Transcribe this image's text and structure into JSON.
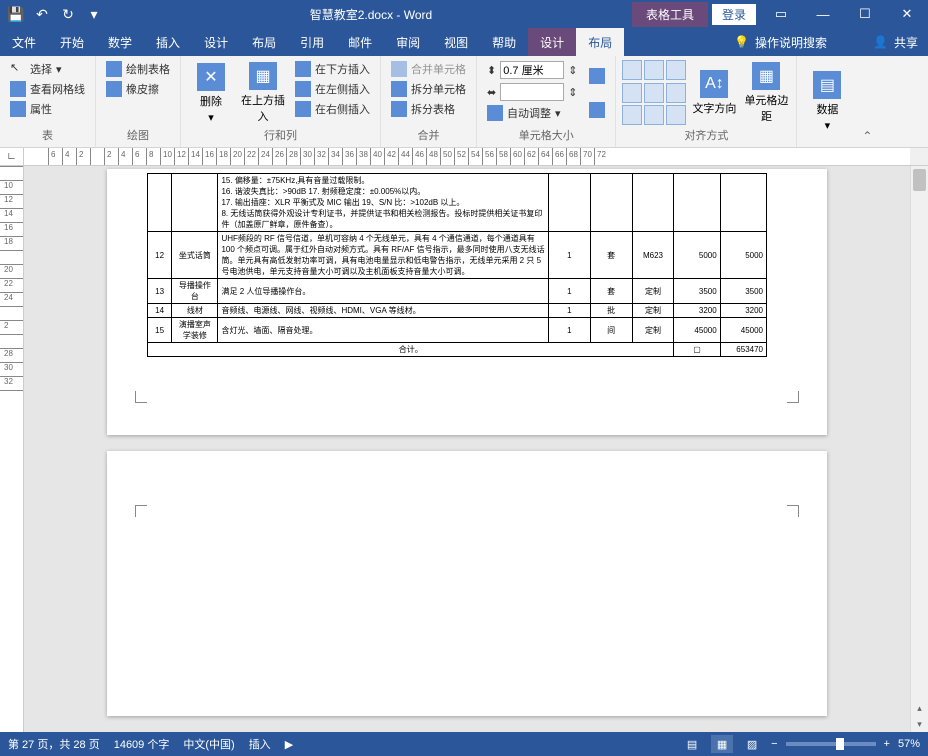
{
  "titlebar": {
    "doc_title": "智慧教室2.docx - Word",
    "tool_tab": "表格工具",
    "login": "登录"
  },
  "tabs": {
    "items": [
      "文件",
      "开始",
      "数学",
      "插入",
      "设计",
      "布局",
      "引用",
      "邮件",
      "审阅",
      "视图",
      "帮助",
      "设计",
      "布局"
    ],
    "active_index": 12,
    "tell_me": "操作说明搜索",
    "share": "共享"
  },
  "ribbon": {
    "group_table": {
      "label": "表",
      "select": "选择",
      "gridlines": "查看网格线",
      "properties": "属性"
    },
    "group_draw": {
      "label": "绘图",
      "draw": "绘制表格",
      "eraser": "橡皮擦"
    },
    "group_rowcol": {
      "label": "行和列",
      "delete": "删除",
      "insert_above": "在上方插入",
      "insert_below": "在下方插入",
      "insert_left": "在左侧插入",
      "insert_right": "在右侧插入"
    },
    "group_merge": {
      "label": "合并",
      "merge": "合并单元格",
      "split_cells": "拆分单元格",
      "split_table": "拆分表格"
    },
    "group_size": {
      "label": "单元格大小",
      "height": "0.7 厘米",
      "width": "",
      "autofit": "自动调整"
    },
    "group_align": {
      "label": "对齐方式",
      "text_dir": "文字方向",
      "cell_margin": "单元格边距"
    },
    "group_data": {
      "label": "数据",
      "btn": "数据"
    }
  },
  "ruler_h": [
    "6",
    "4",
    "2",
    "",
    "2",
    "4",
    "6",
    "8",
    "10",
    "12",
    "14",
    "16",
    "18",
    "20",
    "22",
    "24",
    "26",
    "28",
    "30",
    "32",
    "34",
    "36",
    "38",
    "40",
    "42",
    "44",
    "46",
    "48",
    "50",
    "52",
    "54",
    "56",
    "58",
    "60",
    "62",
    "64",
    "66",
    "68",
    "70",
    "72"
  ],
  "ruler_v": [
    "",
    "10",
    "12",
    "14",
    "16",
    "18",
    "",
    "20",
    "22",
    "24",
    "",
    "2",
    "",
    "28",
    "30",
    "32",
    ""
  ],
  "table": {
    "preamble": [
      "15. 偏移量：±75KHz,具有音量过载限制。",
      "16. 谐波失真比：>90dB 17. 射频稳定度：±0.005%以内。",
      "17. 输出插座：XLR 平衡式及 MIC 输出 19、S/N 比：>102dB 以上。",
      "8. 无线话筒获得外观设计专利证书，并提供证书和相关检测报告。投标时提供相关证书复印件（加盖原厂鲜章，原件备查）。"
    ],
    "rows": [
      {
        "no": "12",
        "name": "坐式话筒",
        "desc": "UHF频段的 RF 信号信道，单机可容纳 4 个无线单元，具有 4 个通信通道，每个通道具有 100 个频点可调。属于红外自动对频方式。具有 RF/AF 信号指示，最多同时使用八支无线话筒。单元具有高低发射功率可调，具有电池电量显示和低电警告指示，无线单元采用 2 只 5 号电池供电，单元支持音量大小可调以及主机面板支持音量大小可调。",
        "u": "1",
        "unit": "套",
        "model": "M623",
        "p1": "5000",
        "p2": "5000"
      },
      {
        "no": "13",
        "name": "导播操作台",
        "desc": "满足 2 人位导播操作台。",
        "u": "1",
        "unit": "套",
        "model": "定制",
        "p1": "3500",
        "p2": "3500"
      },
      {
        "no": "14",
        "name": "线材",
        "desc": "音频线、电源线、网线、视频线、HDMI、VGA 等线材。",
        "u": "1",
        "unit": "批",
        "model": "定制",
        "p1": "3200",
        "p2": "3200"
      },
      {
        "no": "15",
        "name": "演播室声学装修",
        "desc": "含灯光、墙面、隔音处理。",
        "u": "1",
        "unit": "间",
        "model": "定制",
        "p1": "45000",
        "p2": "45000"
      }
    ],
    "total_label": "合计。",
    "total_value": "653470"
  },
  "statusbar": {
    "page": "第 27 页，共 28 页",
    "words": "14609 个字",
    "lang": "中文(中国)",
    "mode": "插入",
    "zoom": "57%"
  }
}
